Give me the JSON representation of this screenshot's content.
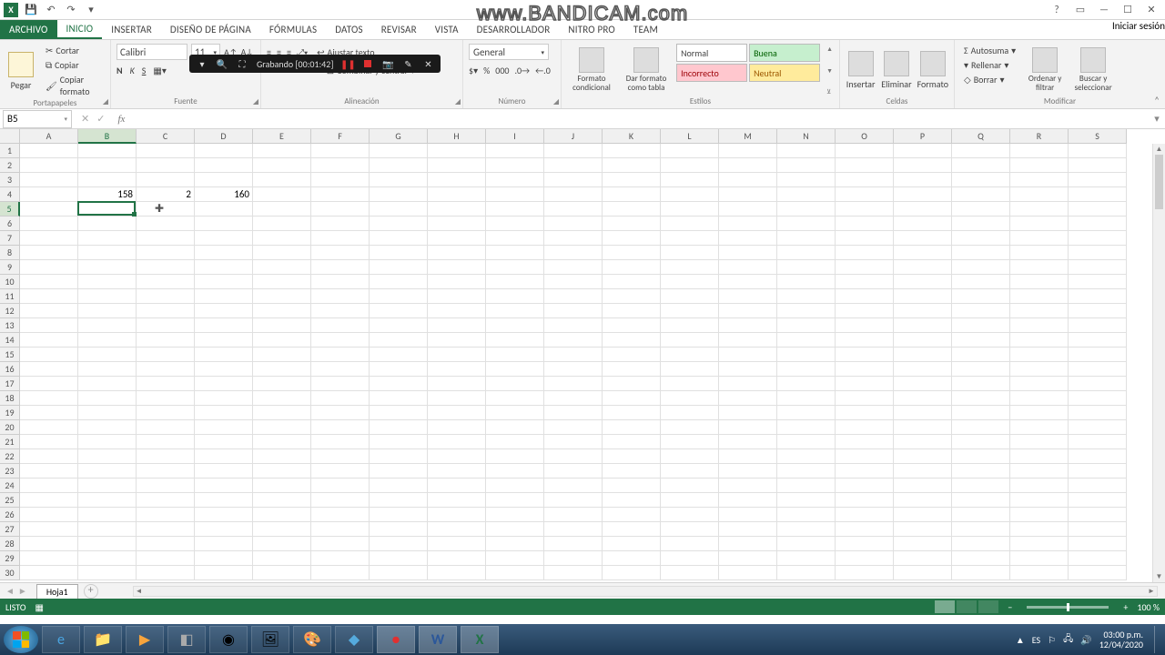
{
  "watermark": "www.BANDICAM.com",
  "titlebar": {
    "signin": "Iniciar sesión"
  },
  "tabs": {
    "file": "ARCHIVO",
    "home": "INICIO",
    "insert": "INSERTAR",
    "pagelayout": "DISEÑO DE PÁGINA",
    "formulas": "FÓRMULAS",
    "data": "DATOS",
    "review": "REVISAR",
    "view": "VISTA",
    "developer": "DESARROLLADOR",
    "nitro": "NITRO PRO",
    "team": "TEAM"
  },
  "ribbon": {
    "clipboard": {
      "paste": "Pegar",
      "cut": "Cortar",
      "copy": "Copiar",
      "format": "Copiar formato",
      "label": "Portapapeles"
    },
    "font": {
      "name": "Calibri",
      "size": "11",
      "label": "Fuente",
      "bold": "N",
      "italic": "K",
      "underline": "S"
    },
    "alignment": {
      "wrap": "Ajustar texto",
      "merge": "Combinar y centrar",
      "label": "Alineación"
    },
    "number": {
      "format": "General",
      "label": "Número"
    },
    "styles": {
      "cond": "Formato condicional",
      "table": "Dar formato como tabla",
      "normal": "Normal",
      "buena": "Buena",
      "incorrecto": "Incorrecto",
      "neutral": "Neutral",
      "label": "Estilos"
    },
    "cells": {
      "insert": "Insertar",
      "delete": "Eliminar",
      "format": "Formato",
      "label": "Celdas"
    },
    "editing": {
      "autosum": "Autosuma",
      "fill": "Rellenar",
      "clear": "Borrar",
      "sort": "Ordenar y filtrar",
      "find": "Buscar y seleccionar",
      "label": "Modificar"
    }
  },
  "recording": {
    "label": "Grabando",
    "time": "[00:01:42]"
  },
  "namebox": "B5",
  "formula": "",
  "columns": [
    "A",
    "B",
    "C",
    "D",
    "E",
    "F",
    "G",
    "H",
    "I",
    "J",
    "K",
    "L",
    "M",
    "N",
    "O",
    "P",
    "Q",
    "R",
    "S"
  ],
  "row_count": 30,
  "sel_col_index": 1,
  "sel_row_index": 4,
  "cells": {
    "r4": {
      "B": "158",
      "C": "2",
      "D": "160"
    }
  },
  "sheet": {
    "name": "Hoja1"
  },
  "status": {
    "ready": "LISTO",
    "zoom": "100 %"
  },
  "tray": {
    "lang": "ES",
    "time": "03:00 p.m.",
    "date": "12/04/2020"
  }
}
